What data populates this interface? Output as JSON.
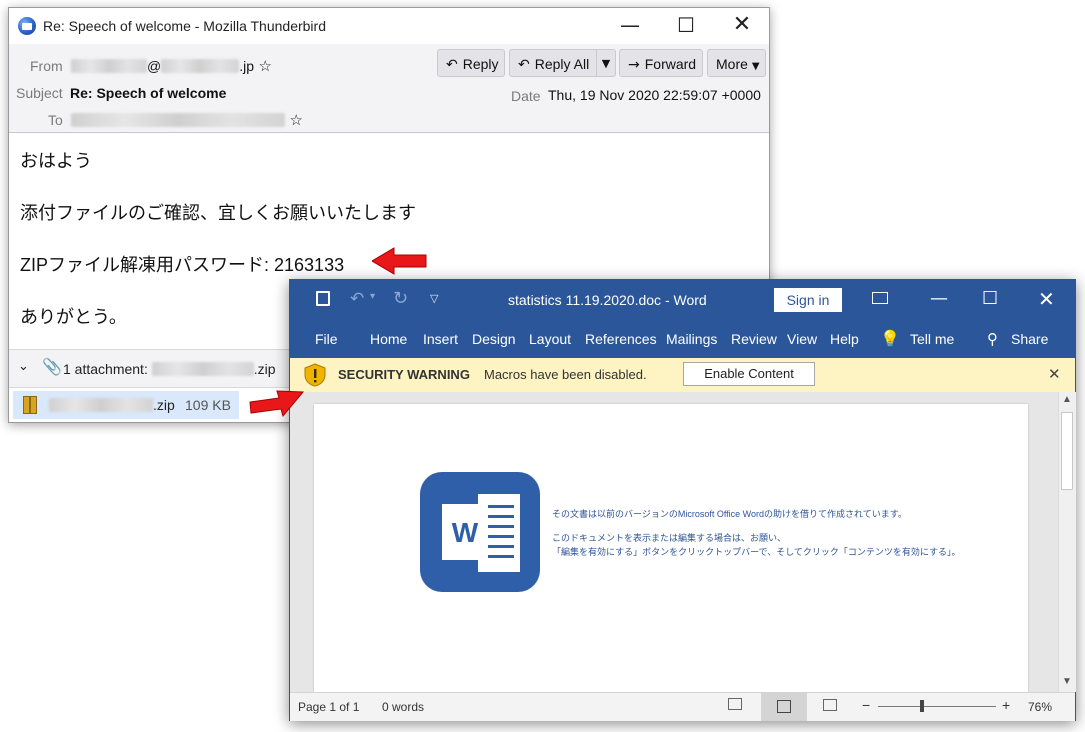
{
  "thunderbird": {
    "window_title": "Re: Speech of welcome - Mozilla Thunderbird",
    "from_label": "From",
    "from_at": "@",
    "from_domain_suffix": ".jp",
    "subject_label": "Subject",
    "subject": "Re: Speech of welcome",
    "to_label": "To",
    "date_label": "Date",
    "date": "Thu, 19 Nov 2020 22:59:07 +0000",
    "buttons": {
      "reply": "Reply",
      "reply_all": "Reply All",
      "forward": "Forward",
      "more": "More"
    },
    "body": {
      "line1": "おはよう",
      "line2": "添付ファイルのご確認、宜しくお願いいたします",
      "line3_prefix": "ZIPファイル解凍用パスワード: ",
      "password": "2163133",
      "line4": "ありがとう。"
    },
    "attachment_bar": {
      "text": "1 attachment: ",
      "suffix": ".zip"
    },
    "attachment_file": {
      "suffix": ".zip",
      "size": "109 KB"
    }
  },
  "word": {
    "window_title": "statistics 11.19.2020.doc  -  Word",
    "signin": "Sign in",
    "tabs": [
      "File",
      "Home",
      "Insert",
      "Design",
      "Layout",
      "References",
      "Mailings",
      "Review",
      "View",
      "Help"
    ],
    "tell_me": "Tell me",
    "share": "Share",
    "security": {
      "title": "SECURITY WARNING",
      "message": "Macros have been disabled.",
      "button": "Enable Content"
    },
    "doc_lines": [
      "その文書は以前のバージョンのMicrosoft Office Wordの助けを借りて作成されています。",
      "このドキュメントを表示または編集する場合は、お願い、",
      "「編集を有効にする」ボタンをクリックトップバーで、そしてクリック「コンテンツを有効にする」。"
    ],
    "word_logo_letter": "W",
    "status": {
      "page": "Page 1 of 1",
      "words": "0 words",
      "zoom": "76%",
      "zoom_minus": "−",
      "zoom_plus": "+"
    }
  },
  "colors": {
    "word_blue": "#2b579a",
    "warning_yellow": "#fdf3c3",
    "arrow_red": "#e8181a",
    "doc_text_blue": "#2f5597"
  }
}
